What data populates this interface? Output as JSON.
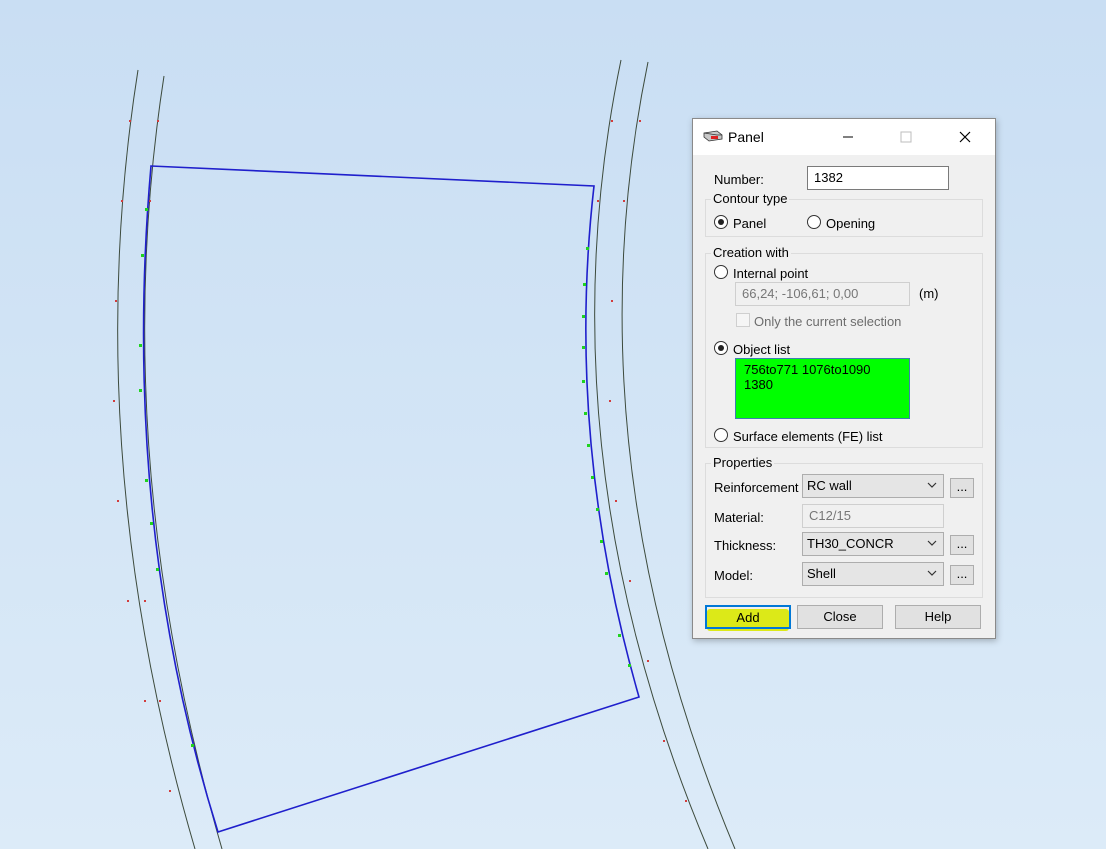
{
  "dialog": {
    "title": "Panel",
    "number_label": "Number:",
    "number_value": "1382",
    "contour_type": {
      "legend": "Contour type",
      "panel": "Panel",
      "opening": "Opening",
      "selected": "panel"
    },
    "creation": {
      "legend": "Creation with",
      "internal_point": "Internal point",
      "coords_value": "66,24; -106,61; 0,00",
      "unit": "(m)",
      "only_current": "Only the current selection",
      "object_list": "Object list",
      "object_list_value": "756to771 1076to1090 1380",
      "surface_elements": "Surface elements (FE) list",
      "selected": "object_list"
    },
    "properties": {
      "legend": "Properties",
      "reinforcement_label": "Reinforcement",
      "reinforcement_value": "RC wall",
      "material_label": "Material:",
      "material_value": "C12/15",
      "thickness_label": "Thickness:",
      "thickness_value": "TH30_CONCR",
      "model_label": "Model:",
      "model_value": "Shell",
      "more": "..."
    },
    "buttons": {
      "add": "Add",
      "close": "Close",
      "help": "Help"
    }
  },
  "colors": {
    "background": "#d3e6f6",
    "panel_contour": "#1f1fcc",
    "object_list_highlight": "#00ff00",
    "add_highlight": "#d9e800"
  }
}
